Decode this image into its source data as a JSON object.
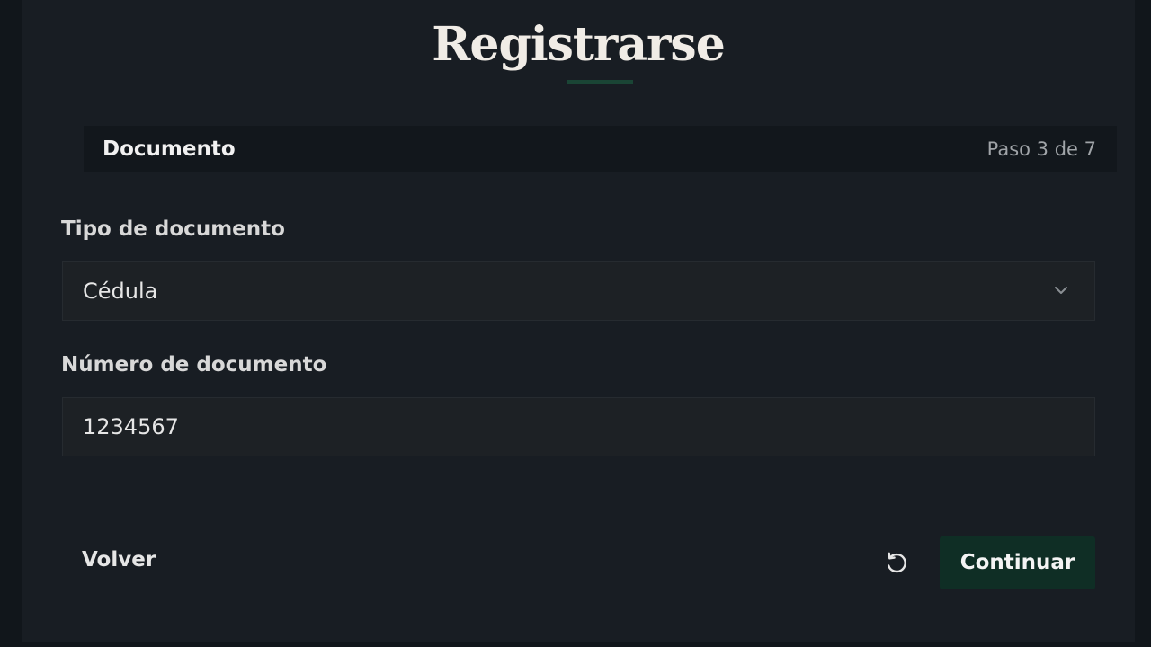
{
  "form": {
    "title": "Registrarse",
    "step": {
      "title": "Documento",
      "count": "Paso 3 de 7"
    },
    "document_type": {
      "label": "Tipo de documento",
      "selected": "Cédula",
      "icon": "chevron-down-icon"
    },
    "document_number": {
      "label": "Número de documento",
      "value": "1234567"
    },
    "actions": {
      "back_label": "Volver",
      "reset_icon": "reset-icon",
      "continue_label": "Continuar"
    }
  },
  "colors": {
    "background": "#11161b",
    "card": "#181d23",
    "accent": "#1a4535",
    "primary_button": "#0f2e25"
  }
}
